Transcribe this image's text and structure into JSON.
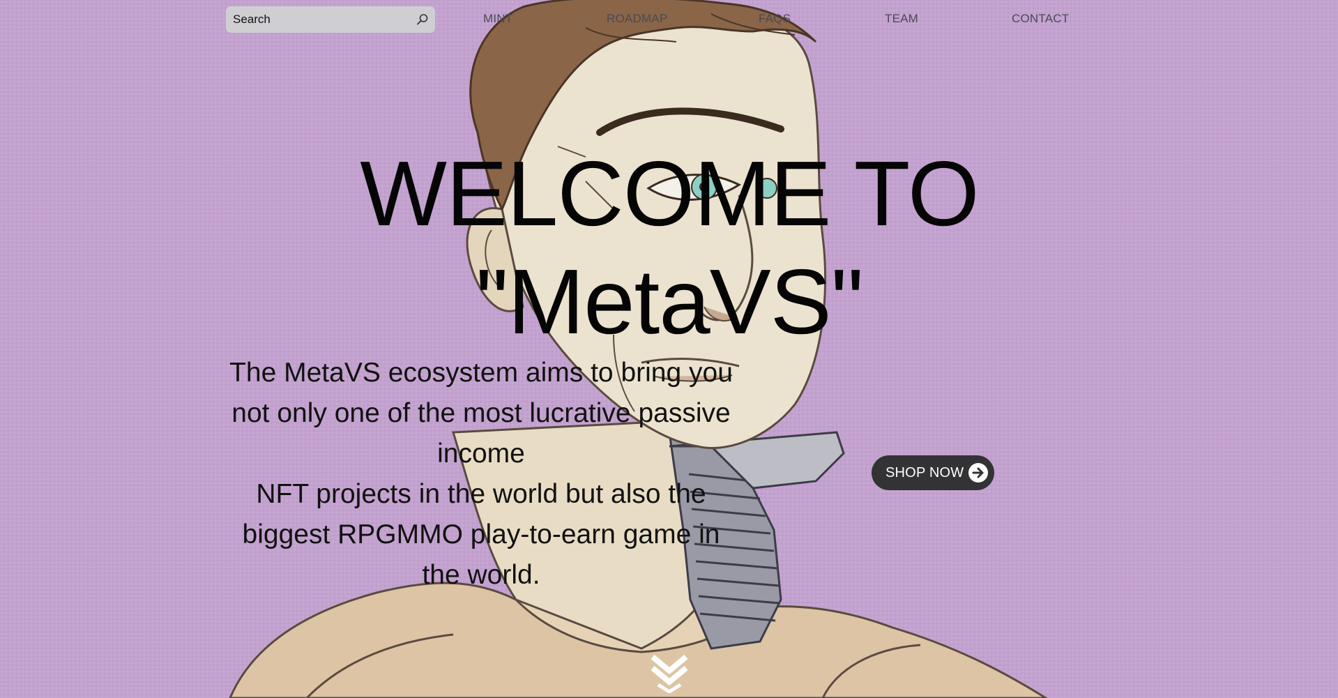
{
  "search": {
    "placeholder": "Search",
    "icon": "search-icon"
  },
  "nav": {
    "items": [
      {
        "label": "MINT"
      },
      {
        "label": "ROADMAP"
      },
      {
        "label": "FAQS"
      },
      {
        "label": "TEAM"
      },
      {
        "label": "CONTACT"
      }
    ]
  },
  "hero": {
    "title_line1": "WELCOME TO",
    "title_line2": "\"MetaVS\"",
    "description_line1": "The MetaVS ecosystem aims to bring you not only one of the most lucrative passive income",
    "description_line2": "NFT projects in the world but also the biggest RPGMMO play-to-earn game in the world."
  },
  "shop_button": {
    "label": "SHOP NOW",
    "icon": "arrow-right-circle-icon"
  },
  "scroll": {
    "icon": "double-chevron-down-icon"
  },
  "colors": {
    "background": "#c3a2cf",
    "button_bg": "#333335",
    "search_bg": "#cfcfd3",
    "text": "#050505",
    "nav_text": "#4a4a52"
  }
}
